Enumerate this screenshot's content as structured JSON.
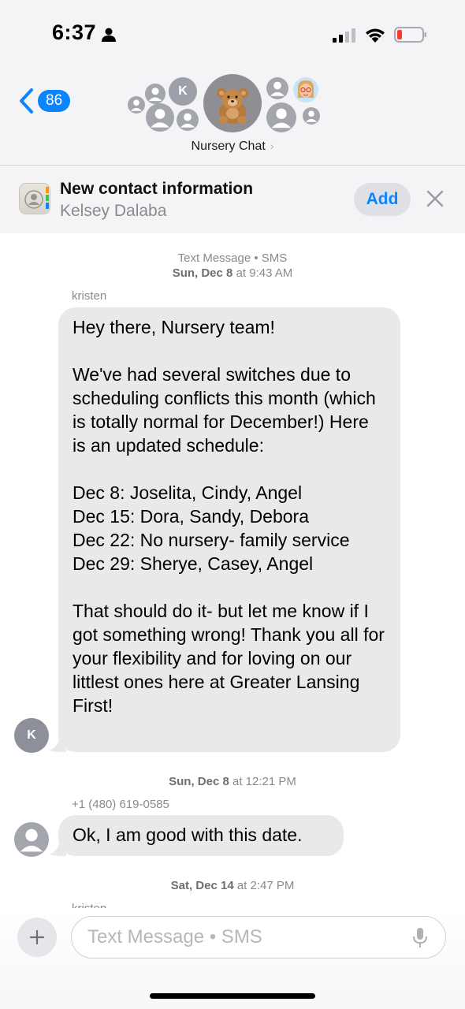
{
  "status_bar": {
    "time": "6:37"
  },
  "header": {
    "back_count": "86",
    "avatar_initial": "K",
    "chat_name": "Nursery Chat",
    "chat_name_chevron": "›"
  },
  "banner": {
    "title": "New contact information",
    "name": "Kelsey Dalaba",
    "add_label": "Add"
  },
  "conversation": {
    "meta1_line1": "Text Message • SMS",
    "meta1_day": "Sun, Dec 8",
    "meta1_at": "at",
    "meta1_time": "9:43 AM",
    "sender1": "kristen",
    "message1": "Hey there, Nursery team!\n\nWe've had several switches due to scheduling conflicts this month (which is totally normal for December!) Here is an updated schedule:\n\nDec 8: Joselita, Cindy, Angel\nDec 15: Dora, Sandy, Debora\nDec 22: No nursery- family service\nDec 29: Sherye, Casey, Angel\n\nThat should do it- but let me know if I got something wrong! Thank you all for your flexibility and for loving on our littlest ones here at Greater Lansing First!",
    "sender1_initial": "K",
    "meta2_day": "Sun, Dec 8",
    "meta2_at": "at",
    "meta2_time": "12:21 PM",
    "sender2": "+1 (480) 619-0585",
    "message2": "Ok, I am good with this date.",
    "meta3_day": "Sat, Dec 14",
    "meta3_at": "at",
    "meta3_time": "2:47 PM",
    "sender3": "kristen"
  },
  "composer": {
    "placeholder": "Text Message • SMS"
  },
  "colors": {
    "accent": "#0a84ff",
    "bubble_gray": "#e9e9eb",
    "header_bg": "#f4f4f6"
  },
  "icons": [
    "person-icon",
    "signal-icon",
    "wifi-icon",
    "battery-icon",
    "back-chevron-icon",
    "teddy-bear-icon",
    "contacts-icon",
    "close-icon",
    "plus-icon",
    "mic-icon"
  ]
}
